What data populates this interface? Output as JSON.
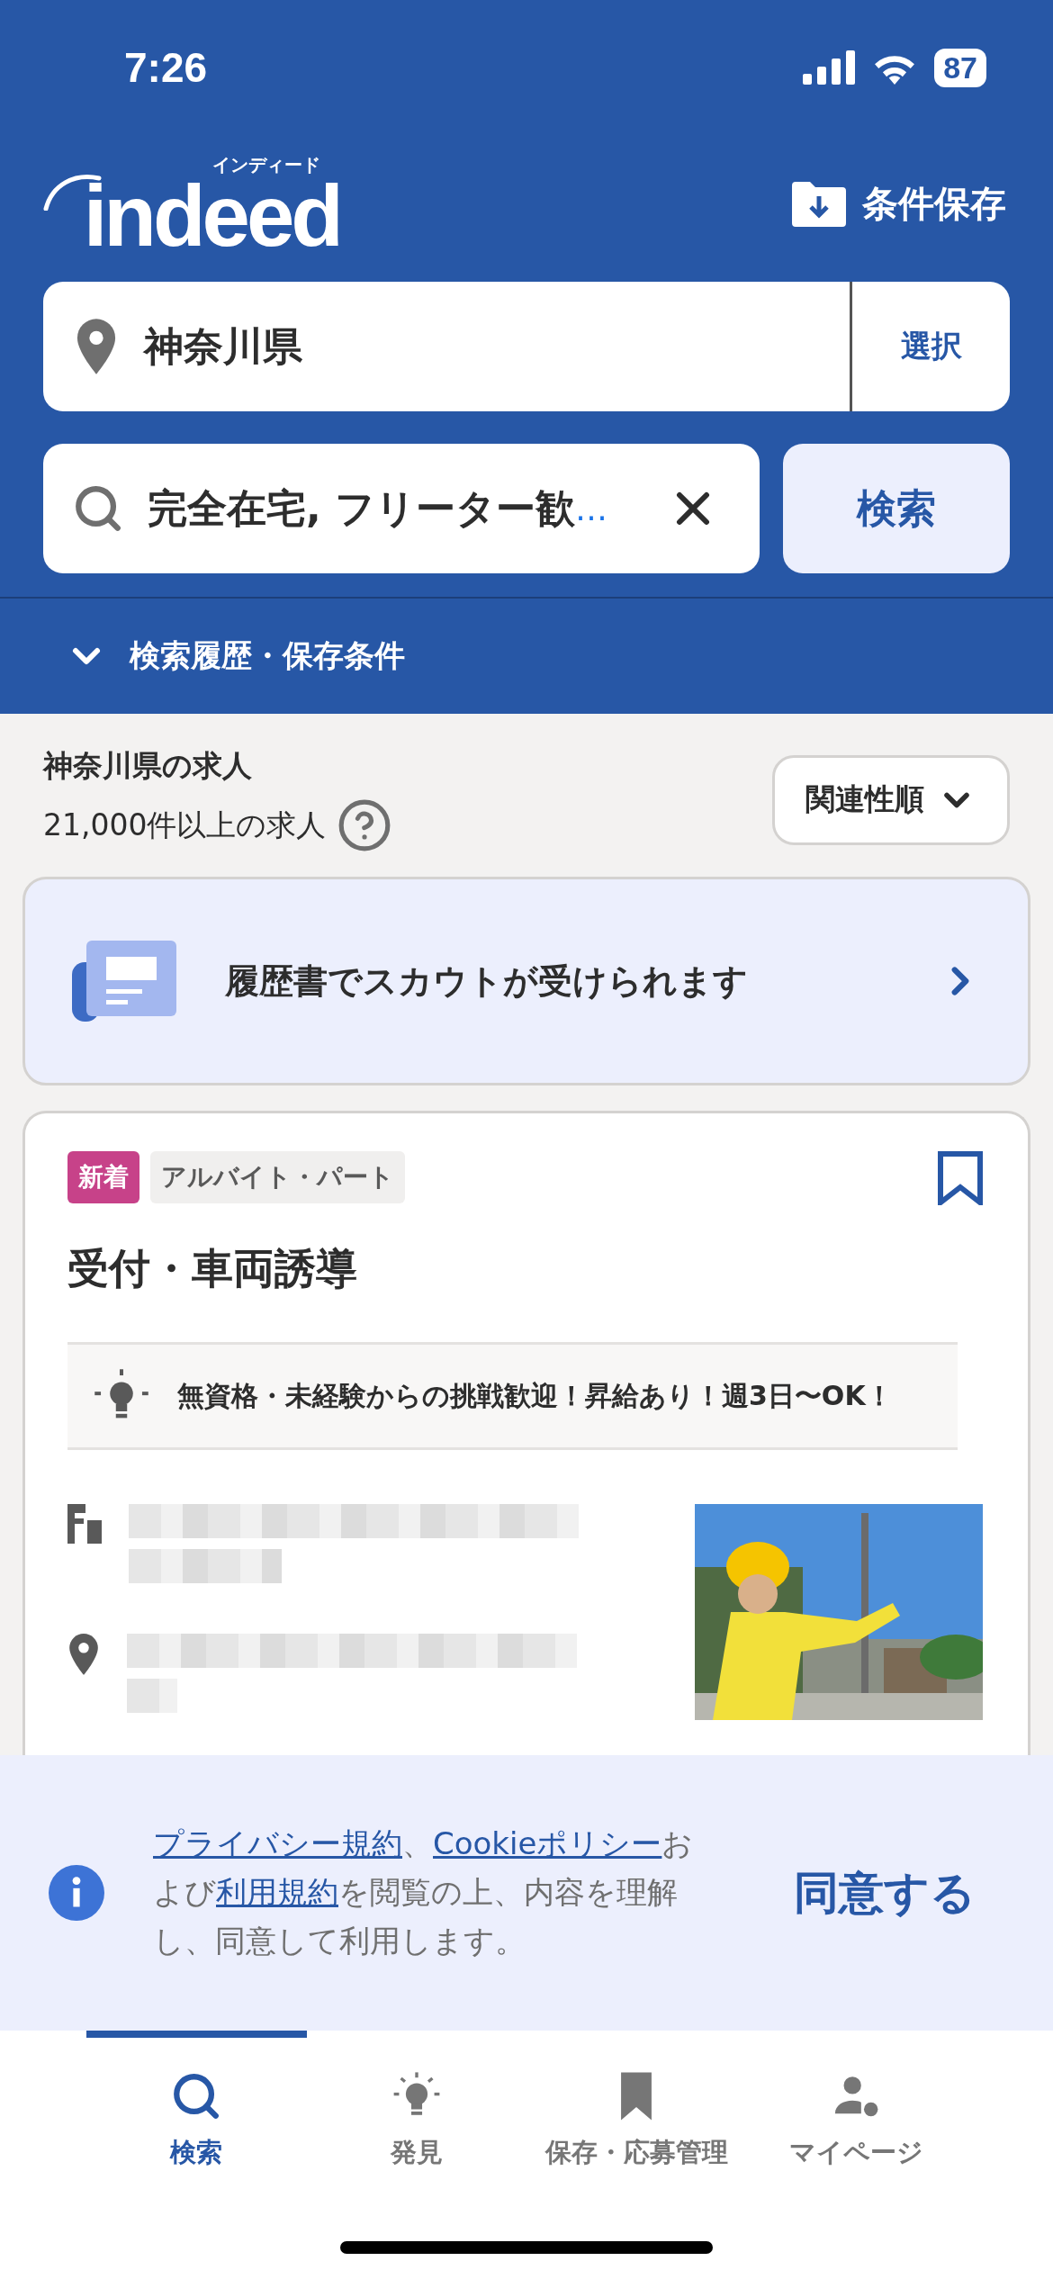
{
  "status_bar": {
    "time": "7:26",
    "battery": "87"
  },
  "header": {
    "logo": {
      "wordmark": "indeed",
      "reading": "インディード"
    },
    "save_button": "条件保存",
    "location": {
      "value": "神奈川県",
      "action": "選択"
    },
    "search": {
      "value": "完全在宅, フリーター歓",
      "overflow_mark": "…",
      "button": "検索"
    },
    "history": {
      "label": "検索履歴・保存条件",
      "expanded": false
    }
  },
  "results": {
    "title": "神奈川県の求人",
    "count": "21,000件以上の求人",
    "sort": "関連性順"
  },
  "scout_banner": {
    "text": "履歴書でスカウトが受けられます"
  },
  "job": {
    "tags": [
      {
        "kind": "new",
        "label": "新着"
      },
      {
        "kind": "type",
        "label": "アルバイト・パート"
      }
    ],
    "saved": false,
    "title": "受付・車両誘導",
    "highlight": "無資格・未経験からの挑戦歓迎！昇給あり！週3日〜OK！"
  },
  "cookie_notice": {
    "parts": [
      {
        "text": "プライバシー規約",
        "link": true
      },
      {
        "text": "、",
        "link": false
      },
      {
        "text": "Cookieポリシー",
        "link": true
      },
      {
        "text": "および",
        "link": false
      },
      {
        "text": "利用規約",
        "link": true
      },
      {
        "text": "を閲覧の上、内容を理解し、同意して利用します。",
        "link": false
      }
    ],
    "agree": "同意する"
  },
  "tab_bar": [
    {
      "kind": "search",
      "label": "検索",
      "selected": true
    },
    {
      "kind": "discover",
      "label": "発見",
      "selected": false
    },
    {
      "kind": "saved",
      "label": "保存・応募管理",
      "selected": false
    },
    {
      "kind": "mypage",
      "label": "マイページ",
      "selected": false
    }
  ]
}
